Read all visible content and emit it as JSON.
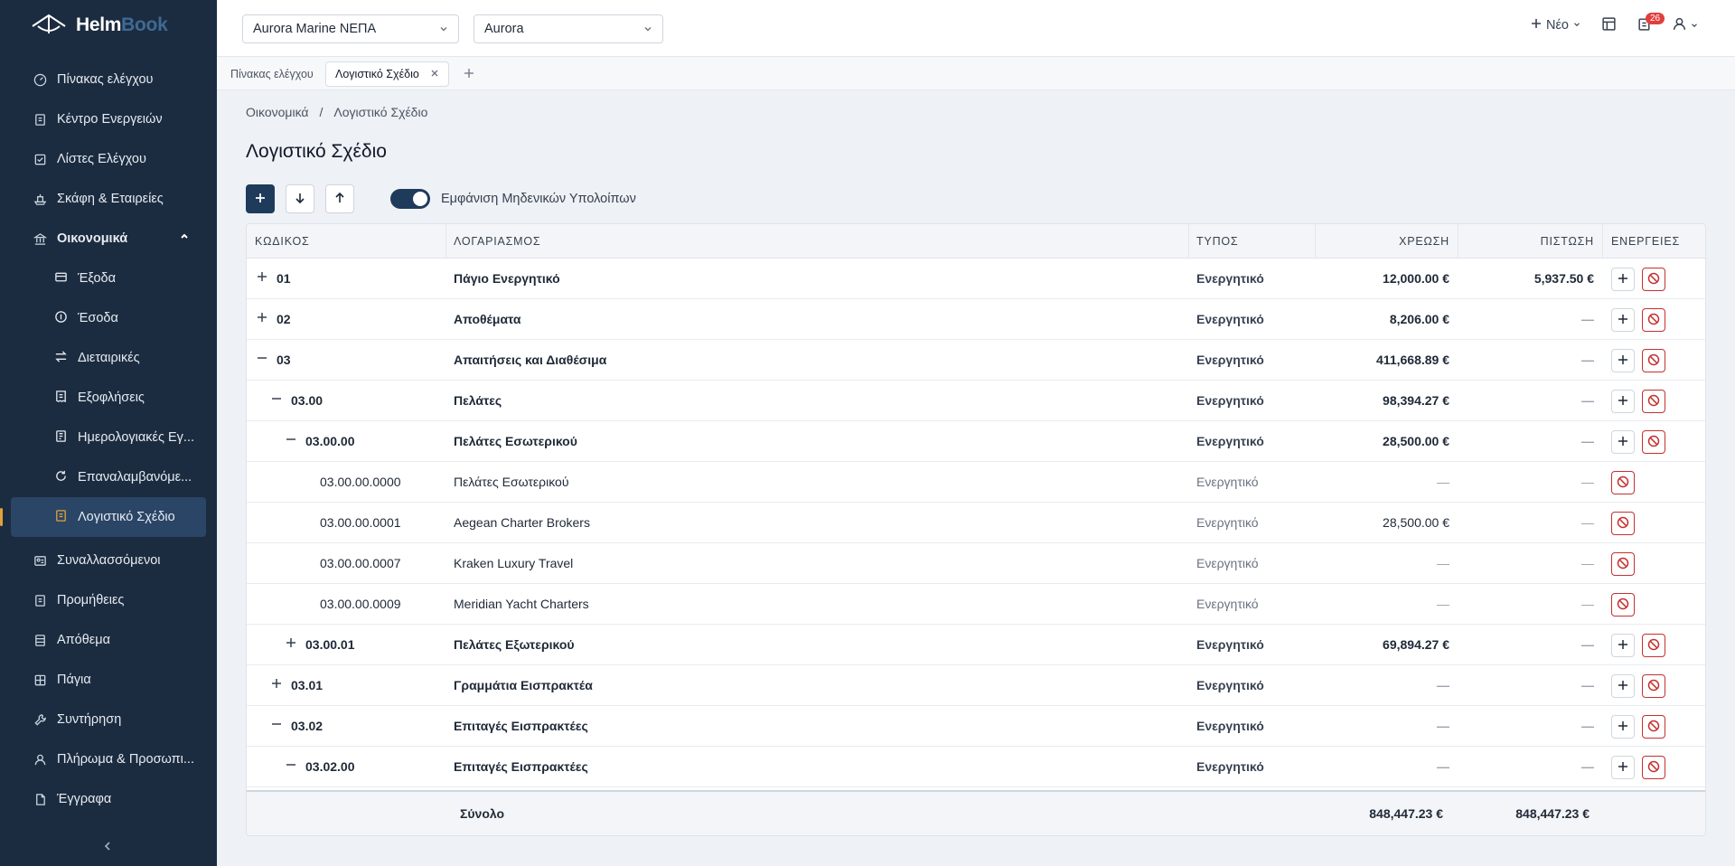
{
  "brand": {
    "name_part1": "Helm",
    "name_part2": "Book"
  },
  "sidebar": {
    "items": [
      {
        "label": "Πίνακας ελέγχου",
        "icon": "gauge-icon"
      },
      {
        "label": "Κέντρο Ενεργειών",
        "icon": "clipboard-icon"
      },
      {
        "label": "Λίστες Ελέγχου",
        "icon": "checklist-icon"
      },
      {
        "label": "Σκάφη & Εταιρείες",
        "icon": "ship-icon"
      },
      {
        "label": "Οικονομικά",
        "icon": "bank-icon",
        "expanded": true
      }
    ],
    "finance_subitems": [
      {
        "label": "Έξοδα",
        "icon": "card-icon"
      },
      {
        "label": "Έσοδα",
        "icon": "coin-icon"
      },
      {
        "label": "Διεταιρικές",
        "icon": "transfer-icon"
      },
      {
        "label": "Εξοφλήσεις",
        "icon": "receipt-icon"
      },
      {
        "label": "Ημερολογιακές Εγ...",
        "icon": "journal-icon"
      },
      {
        "label": "Επαναλαμβανόμε...",
        "icon": "refresh-icon"
      },
      {
        "label": "Λογιστικό Σχέδιο",
        "icon": "ledger-icon",
        "active": true
      }
    ],
    "bottom_items": [
      {
        "label": "Συναλλασσόμενοι",
        "icon": "contacts-icon"
      },
      {
        "label": "Προμήθειες",
        "icon": "cart-icon"
      },
      {
        "label": "Απόθεμα",
        "icon": "box-icon"
      },
      {
        "label": "Πάγια",
        "icon": "assets-icon"
      },
      {
        "label": "Συντήρηση",
        "icon": "wrench-icon"
      },
      {
        "label": "Πλήρωμα & Προσωπι...",
        "icon": "crew-icon"
      },
      {
        "label": "Έγγραφα",
        "icon": "document-icon"
      }
    ]
  },
  "topbar": {
    "company_select": "Aurora Marine ΝΕΠΑ",
    "vessel_select": "Aurora",
    "new_label": "Νέο",
    "notification_count": "26"
  },
  "tabs": [
    {
      "label": "Πίνακας ελέγχου"
    },
    {
      "label": "Λογιστικό Σχέδιο",
      "active": true
    }
  ],
  "breadcrumb": {
    "parent": "Οικονομικά",
    "separator": "/",
    "current": "Λογιστικό Σχέδιο"
  },
  "page_title": "Λογιστικό Σχέδιο",
  "toolbar": {
    "toggle_label": "Εμφάνιση Μηδενικών Υπολοίπων",
    "toggle_on": true
  },
  "table": {
    "headers": {
      "code": "ΚΩΔΙΚΟΣ",
      "account": "ΛΟΓΑΡΙΑΣΜΟΣ",
      "type": "ΤΥΠΟΣ",
      "debit": "ΧΡΕΩΣΗ",
      "credit": "ΠΙΣΤΩΣΗ",
      "actions": "ΕΝΕΡΓΕΙΕΣ"
    },
    "rows": [
      {
        "level": 0,
        "toggle": "+",
        "code": "01",
        "name": "Πάγιο Ενεργητικό",
        "type": "Ενεργητικό",
        "debit": "12,000.00 €",
        "credit": "5,937.50 €",
        "bold": true,
        "add": true
      },
      {
        "level": 0,
        "toggle": "+",
        "code": "02",
        "name": "Αποθέματα",
        "type": "Ενεργητικό",
        "debit": "8,206.00 €",
        "credit": "—",
        "bold": true,
        "add": true
      },
      {
        "level": 0,
        "toggle": "–",
        "code": "03",
        "name": "Απαιτήσεις και Διαθέσιμα",
        "type": "Ενεργητικό",
        "debit": "411,668.89 €",
        "credit": "—",
        "bold": true,
        "add": true
      },
      {
        "level": 1,
        "toggle": "–",
        "code": "03.00",
        "name": "Πελάτες",
        "type": "Ενεργητικό",
        "debit": "98,394.27 €",
        "credit": "—",
        "bold": true,
        "add": true
      },
      {
        "level": 2,
        "toggle": "–",
        "code": "03.00.00",
        "name": "Πελάτες Εσωτερικού",
        "type": "Ενεργητικό",
        "debit": "28,500.00 €",
        "credit": "—",
        "bold": true,
        "add": true
      },
      {
        "level": 3,
        "toggle": "",
        "code": "03.00.00.0000",
        "name": "Πελάτες Εσωτερικού",
        "type": "Ενεργητικό",
        "debit": "—",
        "credit": "—",
        "bold": false,
        "add": false
      },
      {
        "level": 3,
        "toggle": "",
        "code": "03.00.00.0001",
        "name": "Aegean Charter Brokers",
        "type": "Ενεργητικό",
        "debit": "28,500.00 €",
        "credit": "—",
        "bold": false,
        "add": false
      },
      {
        "level": 3,
        "toggle": "",
        "code": "03.00.00.0007",
        "name": "Kraken Luxury Travel",
        "type": "Ενεργητικό",
        "debit": "—",
        "credit": "—",
        "bold": false,
        "add": false
      },
      {
        "level": 3,
        "toggle": "",
        "code": "03.00.00.0009",
        "name": "Meridian Yacht Charters",
        "type": "Ενεργητικό",
        "debit": "—",
        "credit": "—",
        "bold": false,
        "add": false
      },
      {
        "level": 2,
        "toggle": "+",
        "code": "03.00.01",
        "name": "Πελάτες Εξωτερικού",
        "type": "Ενεργητικό",
        "debit": "69,894.27 €",
        "credit": "—",
        "bold": true,
        "add": true
      },
      {
        "level": 1,
        "toggle": "+",
        "code": "03.01",
        "name": "Γραμμάτια Εισπρακτέα",
        "type": "Ενεργητικό",
        "debit": "—",
        "credit": "—",
        "bold": true,
        "add": true
      },
      {
        "level": 1,
        "toggle": "–",
        "code": "03.02",
        "name": "Επιταγές Εισπρακτέες",
        "type": "Ενεργητικό",
        "debit": "—",
        "credit": "—",
        "bold": true,
        "add": true
      },
      {
        "level": 2,
        "toggle": "–",
        "code": "03.02.00",
        "name": "Επιταγές Εισπρακτέες",
        "type": "Ενεργητικό",
        "debit": "—",
        "credit": "—",
        "bold": true,
        "add": true
      }
    ],
    "footer": {
      "label": "Σύνολο",
      "debit_total": "848,447.23 €",
      "credit_total": "848,447.23 €"
    }
  }
}
